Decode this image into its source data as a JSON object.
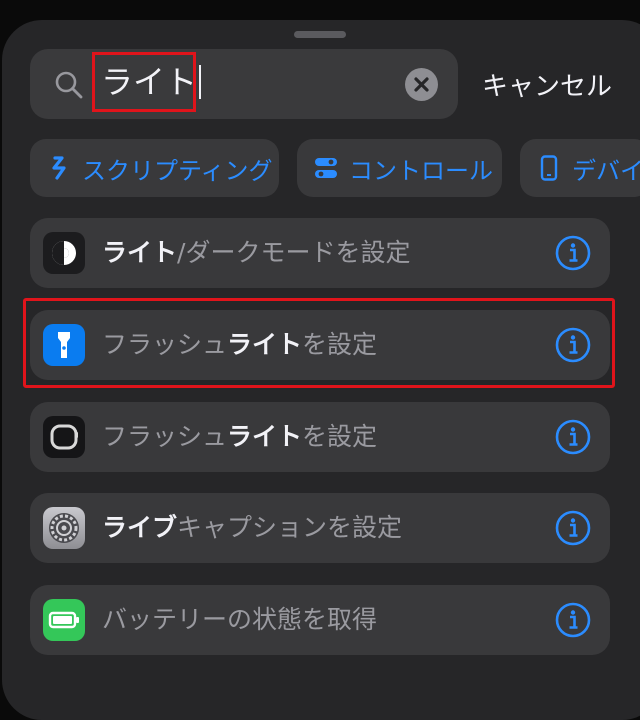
{
  "search": {
    "query": "ライト",
    "cancel_label": "キャンセル"
  },
  "chips": [
    {
      "label": "スクリプティング",
      "icon": "scripting-icon"
    },
    {
      "label": "コントロール",
      "icon": "toggle-icon"
    },
    {
      "label": "デバイス",
      "icon": "iphone-icon"
    }
  ],
  "results": [
    {
      "prefix": "",
      "bold": "ライト",
      "suffix": "/ダークモードを設定",
      "icon": "appearance-icon"
    },
    {
      "prefix": "フラッシュ",
      "bold": "ライト",
      "suffix": "を設定",
      "icon": "flashlight-icon"
    },
    {
      "prefix": "フラッシュ",
      "bold": "ライト",
      "suffix": "を設定",
      "icon": "watch-icon"
    },
    {
      "prefix": "",
      "bold": "ライブ",
      "suffix": "キャプションを設定",
      "icon": "settings-gear-icon"
    },
    {
      "prefix": "",
      "bold": "",
      "suffix": "バッテリーの状態を取得",
      "icon": "battery-icon"
    }
  ],
  "colors": {
    "accent": "#2b8cff",
    "highlight": "#e0141b",
    "cell": "#39393b",
    "sheet": "#262628"
  }
}
